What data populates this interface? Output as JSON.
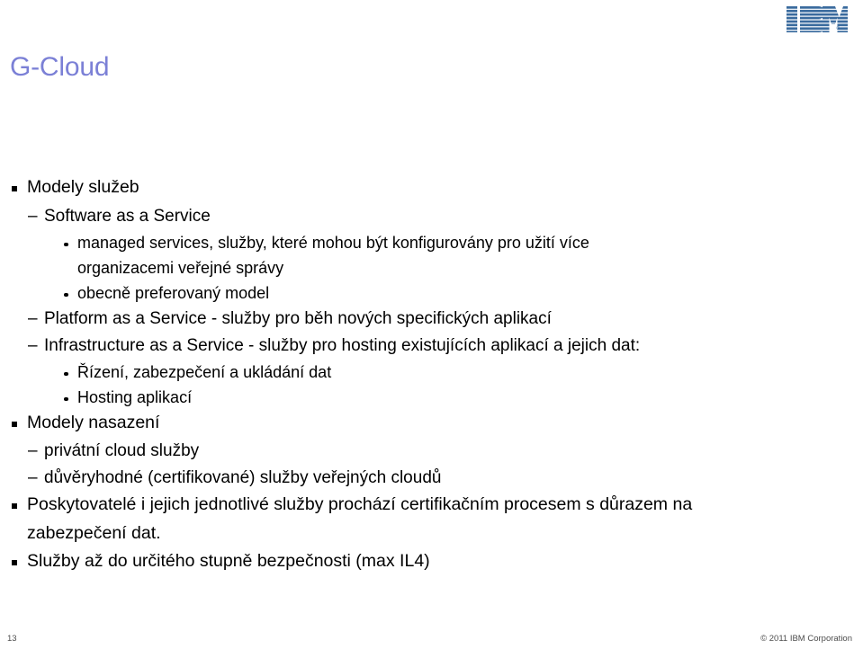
{
  "brand": {
    "logo_name": "IBM",
    "logo_color": "#3a6b9e",
    "registered_mark": "®"
  },
  "title": {
    "text": "G-Cloud",
    "color": "#7b80d6"
  },
  "content": {
    "lines": [
      {
        "level": 1,
        "text": "Modely služeb"
      },
      {
        "level": 2,
        "text": "Software as a Service"
      },
      {
        "level": 3,
        "text": "managed services, služby, které mohou být konfigurovány pro užití více"
      },
      {
        "level": 0,
        "text": "organizacemi veřejné správy"
      },
      {
        "level": 3,
        "text": "obecně preferovaný model"
      },
      {
        "level": 2,
        "text": "Platform as a Service - služby pro běh nových specifických aplikací"
      },
      {
        "level": 2,
        "text": "Infrastructure as a Service - služby pro hosting existujících aplikací a jejich dat:"
      },
      {
        "level": 3,
        "text": "Řízení, zabezpečení a ukládání dat"
      },
      {
        "level": 3,
        "text": "Hosting aplikací"
      },
      {
        "level": 1,
        "text": "Modely nasazení"
      },
      {
        "level": 2,
        "text": "privátní cloud služby"
      },
      {
        "level": 2,
        "text": "důvěryhodné (certifikované) služby veřejných cloudů"
      },
      {
        "level": 1,
        "text": "Poskytovatelé i jejich jednotlivé služby prochází certifikačním procesem s důrazem na"
      },
      {
        "level": 4,
        "text": "zabezpečení dat."
      },
      {
        "level": 1,
        "text": "Služby až do určitého stupně bezpečnosti (max IL4)"
      }
    ],
    "markers": {
      "level1": "square",
      "level2": "–",
      "level3": "dot"
    }
  },
  "footer": {
    "page_number": "13",
    "copyright": "© 2011 IBM Corporation"
  }
}
